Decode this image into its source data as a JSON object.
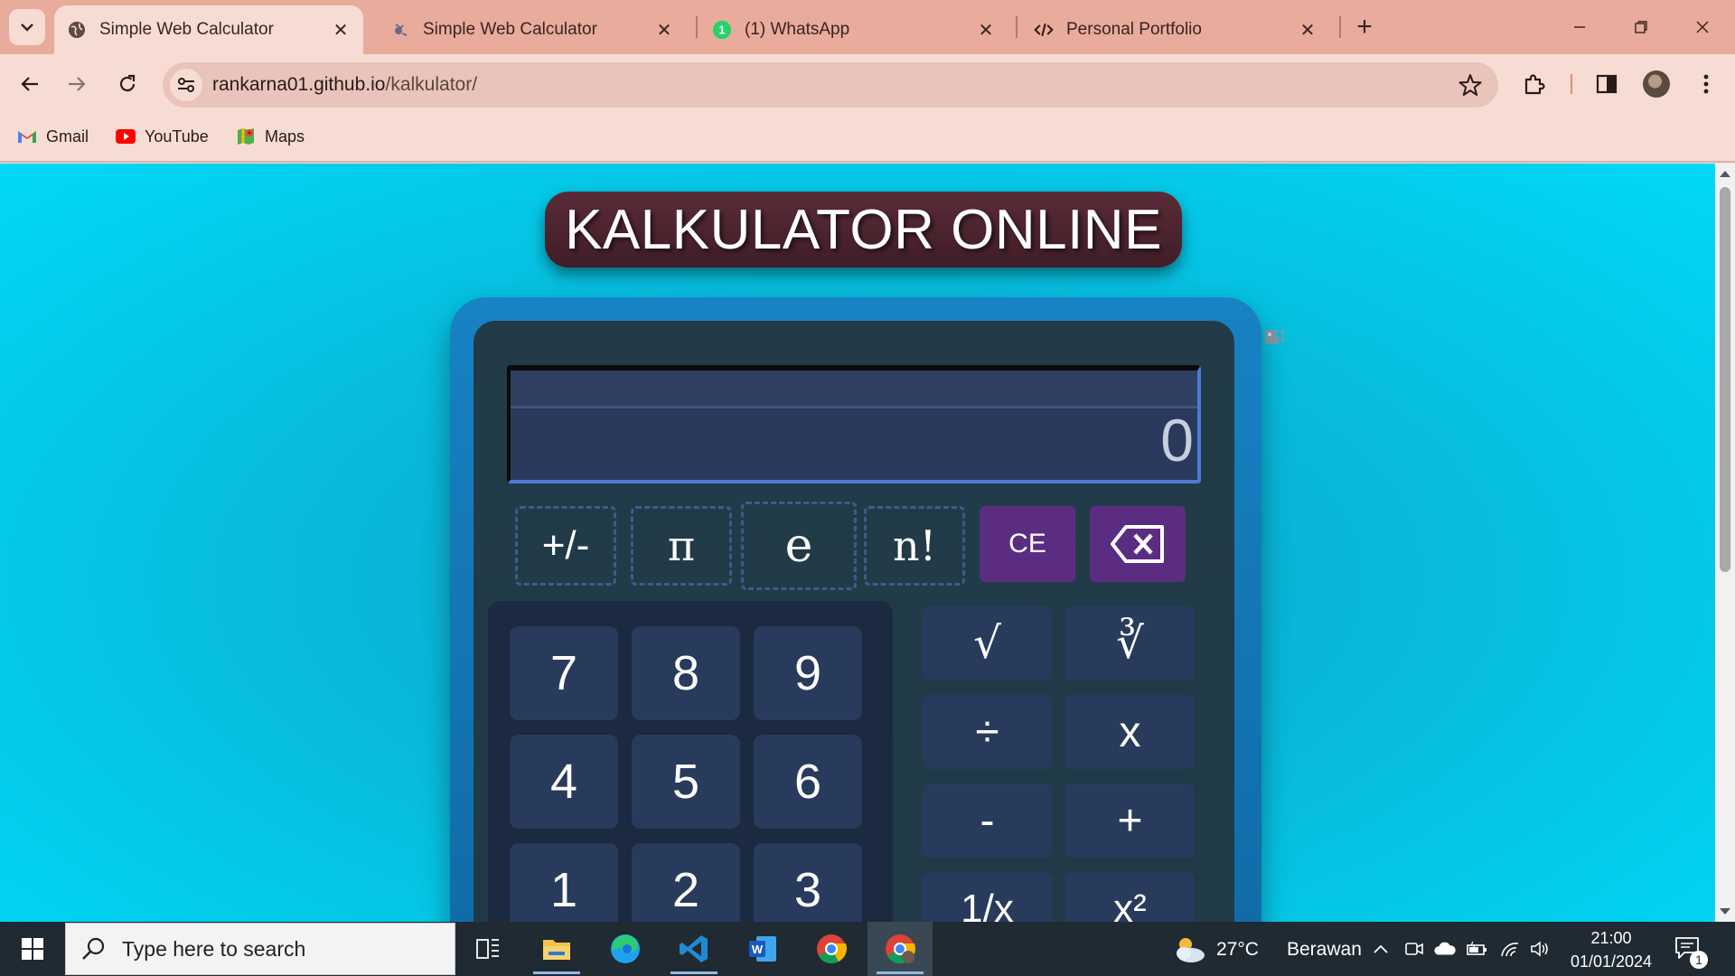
{
  "browser": {
    "tabs": [
      {
        "title": "Simple Web Calculator",
        "active": true,
        "favicon": "globe-icon"
      },
      {
        "title": "Simple Web Calculator",
        "active": false,
        "favicon": "calculator-favicon-icon"
      },
      {
        "title": "(1) WhatsApp",
        "active": false,
        "favicon": "whatsapp-icon",
        "badge": "1"
      },
      {
        "title": "Personal Portfolio",
        "active": false,
        "favicon": "code-icon"
      }
    ],
    "tab_close_glyph": "✕",
    "new_tab_glyph": "+",
    "url_host": "rankarna01.github.io",
    "url_path": "/kalkulator/",
    "bookmarks": [
      {
        "label": "Gmail",
        "icon": "gmail-icon"
      },
      {
        "label": "YouTube",
        "icon": "youtube-icon"
      },
      {
        "label": "Maps",
        "icon": "maps-icon"
      }
    ],
    "colors": {
      "tabstrip": "#e8ab9c",
      "toolbar": "#f7dcd3"
    }
  },
  "page": {
    "title": "KALKULATOR ONLINE",
    "display": {
      "history": "",
      "current": "0"
    },
    "function_keys": [
      "+/-",
      "π",
      "e",
      "n!"
    ],
    "clear_key": "CE",
    "backspace_icon": "backspace-icon",
    "numpad": [
      [
        "7",
        "8",
        "9"
      ],
      [
        "4",
        "5",
        "6"
      ],
      [
        "1",
        "2",
        "3"
      ]
    ],
    "operators": [
      [
        "√",
        "∛"
      ],
      [
        "÷",
        "x"
      ],
      [
        "-",
        "+"
      ],
      [
        "1/x",
        "x²"
      ]
    ],
    "colors": {
      "background": "#08b9da",
      "calc_frame": "#1782c4",
      "calc_body": "#233b48",
      "key": "#293b5c",
      "clear_key": "#5b2d82",
      "title_banner": "#4a2430"
    }
  },
  "taskbar": {
    "search_placeholder": "Type here to search",
    "weather": {
      "temp": "27°C",
      "condition": "Berawan"
    },
    "time": "21:00",
    "date": "01/01/2024",
    "notifications": "1"
  }
}
